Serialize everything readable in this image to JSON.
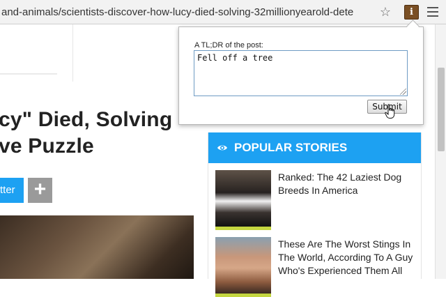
{
  "browser": {
    "url": "and-animals/scientists-discover-how-lucy-died-solving-32millionyearold-dete",
    "bookmark_icon": "star-outline-icon",
    "extension_icon": "info-extension-icon",
    "extension_glyph": "i",
    "menu_icon": "hamburger-menu-icon"
  },
  "article": {
    "title_line1": "cy\" Died, Solving",
    "title_line2": "ve Puzzle",
    "share_label": "tter",
    "more_share_label": "+"
  },
  "sidebar": {
    "header_icon": "eye-icon",
    "header_title": "POPULAR STORIES",
    "stories": [
      {
        "title": "Ranked: The 42 Laziest Dog Breeds In America"
      },
      {
        "title": "These Are The Worst Stings In The World, According To A Guy Who's Experienced Them All"
      }
    ]
  },
  "popup": {
    "label": "A TL;DR of the post:",
    "textarea_value": "Fell off a tree",
    "submit_label": "Submit"
  },
  "colors": {
    "accent_blue": "#1da1f2",
    "story_underline": "#c4d640",
    "extension_brown": "#7a4f24"
  }
}
